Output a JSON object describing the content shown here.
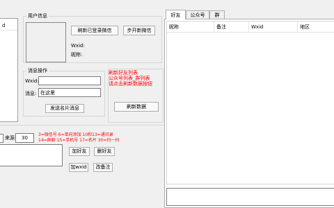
{
  "left_list": {
    "header_text": "d"
  },
  "user_info": {
    "group_title": "用户信息",
    "refresh_login_button": "刷新已登录微信",
    "sync_new_button": "步开新微信",
    "wxid_label": "Wxid:",
    "nickname_label": "昵称:"
  },
  "message": {
    "group_title": "消息操作",
    "wxid_label": "Wxid:",
    "message_label": "消息:",
    "message_value": "在这里",
    "send_card_button": "发送名片消息"
  },
  "notes": {
    "lines": [
      "刷新好友列表",
      "公众号列表_群列表",
      "请点击刷新数据按钮"
    ],
    "refresh_data_button": "刷新数据"
  },
  "friend_ops": {
    "source_label": "来源:",
    "source_value": "30",
    "hint_line1": "3=微信号 6=单向添加 10和13=通讯录",
    "hint_line2": "14=群聊 15=手机号 17=名片 30=扫一扫",
    "add_friend_button": "加好友",
    "delete_friend_button": "删好友",
    "add_wxid_button": "加wxid",
    "remark_button": "改备注"
  },
  "tabs": [
    {
      "label": "好友",
      "active": true
    },
    {
      "label": "公众号",
      "active": false
    },
    {
      "label": "群",
      "active": false
    }
  ],
  "table": {
    "columns": [
      "昵称",
      "备注",
      "Wxid",
      "地区"
    ]
  }
}
